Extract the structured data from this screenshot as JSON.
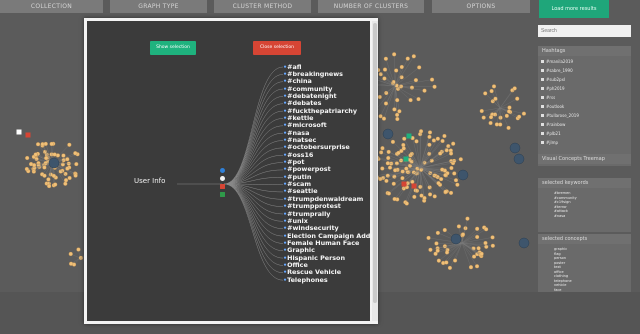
{
  "tabs": [
    {
      "label": "COLLECTION"
    },
    {
      "label": "GRAPH TYPE"
    },
    {
      "label": "CLUSTER METHOD"
    },
    {
      "label": "NUMBER OF CLUSTERS"
    },
    {
      "label": "OPTIONS"
    }
  ],
  "top_action": {
    "label": "Load more results"
  },
  "sidebar": {
    "search_placeholder": "Search",
    "hashtags_title": "Hashtags",
    "hashtags": [
      "#manila2019",
      "#sabre_1990",
      "#sub2pxl",
      "#ph2019",
      "#rss",
      "#outlook",
      "#tullarose_2019",
      "#rainbow",
      "#plb21",
      "#jlmp"
    ],
    "visual_concepts_title": "Visual Concepts Treemap",
    "selected_keywords_title": "selected keywords",
    "selected_keywords": [
      "#bremen",
      "#community",
      "#c19sign",
      "#terror",
      "#attack",
      "#nasa"
    ],
    "selected_concepts_title": "selected concepts",
    "selected_concepts": [
      "graphic",
      "flag",
      "person",
      "poster",
      "text",
      "office",
      "clothing",
      "telephone",
      "vehicle",
      "face"
    ]
  },
  "modal": {
    "button_expand": "Show selection",
    "button_close": "Close selection",
    "root_label": "User Info",
    "leaves": [
      "#afl",
      "#breakingnews",
      "#china",
      "#community",
      "#debatenight",
      "#debates",
      "#fuckthepatriarchy",
      "#kettle",
      "#microsoft",
      "#nasa",
      "#natsec",
      "#octobersurprise",
      "#oss16",
      "#pot",
      "#powerpost",
      "#putin",
      "#scam",
      "#seattle",
      "#trumpdenwaldream",
      "#trumpprotest",
      "#trumprally",
      "#unix",
      "#windsecurity",
      "Election Campaign Addr",
      "Female Human Face",
      "Graphic",
      "Hispanic Person",
      "Office",
      "Rescue Vehicle",
      "Telephones"
    ]
  },
  "colors": {
    "background": "#5b5b5b",
    "tab": "#7a7a7a",
    "accent_green": "#1fb27e",
    "accent_red": "#d64534",
    "node": "#f0c078",
    "cluster_node": "#3e556c",
    "leaf_marker": "#67a8ff"
  }
}
